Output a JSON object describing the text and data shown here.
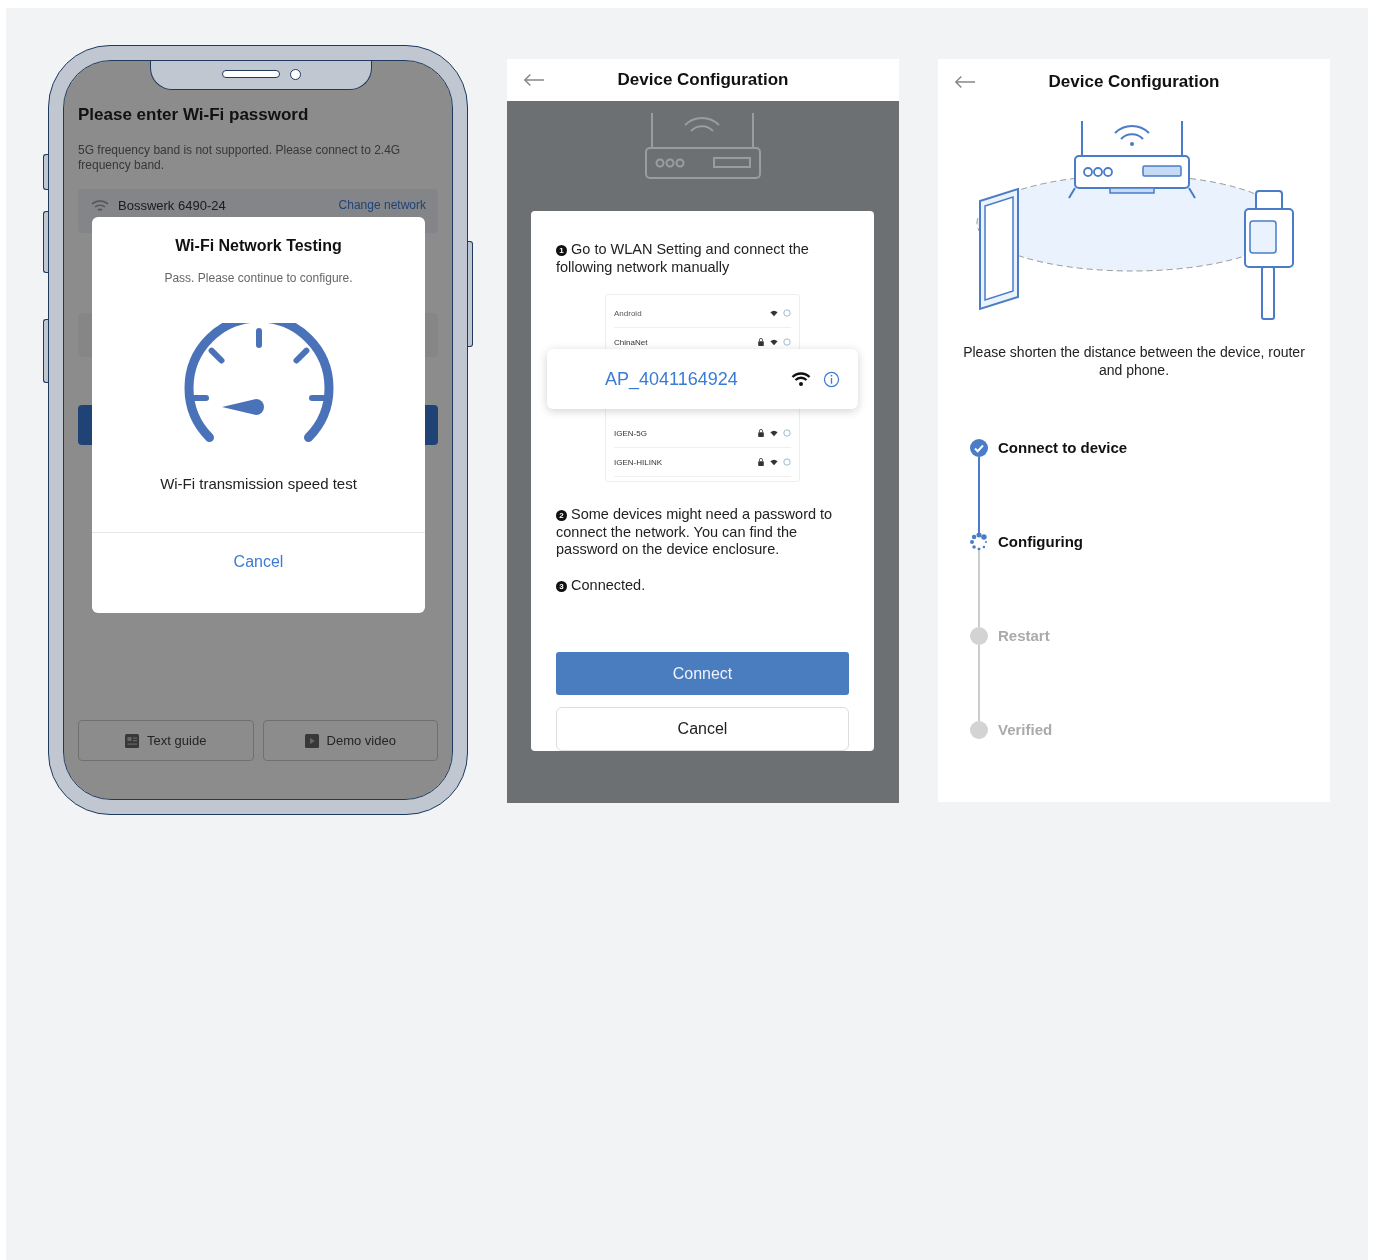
{
  "phone_screen": {
    "title": "Please enter Wi-Fi password",
    "hint": "5G frequency band is not supported. Please connect to 2.4G frequency band.",
    "network": {
      "name": "Bosswerk 6490-24",
      "action": "Change network"
    },
    "guide_buttons": [
      {
        "label": "Text guide",
        "kind": "guide"
      },
      {
        "label": "Demo video",
        "kind": "video"
      }
    ],
    "dialog": {
      "title": "Wi-Fi Network Testing",
      "status": "Pass. Please continue to configure.",
      "caption": "Wi-Fi transmission speed test",
      "cancel": "Cancel"
    }
  },
  "manual_connect": {
    "title": "Device Configuration",
    "steps": [
      {
        "number": "1",
        "text": "Go to WLAN Setting and connect the following network manually"
      },
      {
        "number": "2",
        "text": "Some devices might need a password to connect the network. You can find the password on the device enclosure."
      },
      {
        "number": "3",
        "text": "Connected."
      }
    ],
    "network_list": [
      {
        "name": "Android",
        "kind": "header"
      },
      {
        "name": "ChinaNet",
        "kind": "network"
      },
      {
        "name": "AP_4041164924",
        "kind": "highlight"
      },
      {
        "name": "IGEN-5G",
        "kind": "network"
      },
      {
        "name": "IGEN-HILINK",
        "kind": "network"
      }
    ],
    "buttons": [
      {
        "label": "Connect",
        "kind": "primary"
      },
      {
        "label": "Cancel",
        "kind": "secondary"
      }
    ]
  },
  "progress": {
    "title": "Device Configuration",
    "note": "Please shorten the distance between the device, router and phone.",
    "steps": [
      {
        "label": "Connect to device",
        "kind": "done"
      },
      {
        "label": "Configuring",
        "kind": "active"
      },
      {
        "label": "Restart",
        "kind": "pending"
      },
      {
        "label": "Verified",
        "kind": "pending"
      }
    ]
  }
}
